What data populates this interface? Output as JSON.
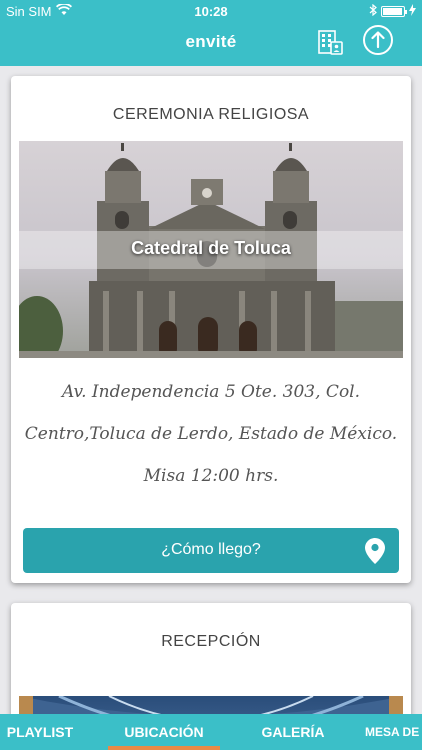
{
  "status_bar": {
    "carrier": "Sin SIM",
    "time": "10:28"
  },
  "header": {
    "title": "envité"
  },
  "cards": [
    {
      "title": "CEREMONIA RELIGIOSA",
      "image_caption": "Catedral de Toluca",
      "address_lines": [
        "Av. Independencia 5 Ote. 303, Col.",
        "Centro,Toluca de Lerdo, Estado de México.",
        "Misa 12:00 hrs."
      ],
      "button_label": "¿Cómo llego?"
    },
    {
      "title": "RECEPCIÓN"
    }
  ],
  "tabs": [
    {
      "label": "PLAYLIST",
      "active": false
    },
    {
      "label": "UBICACIÓN",
      "active": true
    },
    {
      "label": "GALERÍA",
      "active": false
    },
    {
      "label": "MESA DE",
      "active": false
    }
  ],
  "colors": {
    "brand": "#3bbfc8",
    "button": "#2aa3ad",
    "active_tab_indicator": "#e98a46"
  },
  "icons": [
    "wifi-icon",
    "bluetooth-icon",
    "battery-icon",
    "building-icon",
    "share-upload-icon",
    "location-pin-icon"
  ]
}
